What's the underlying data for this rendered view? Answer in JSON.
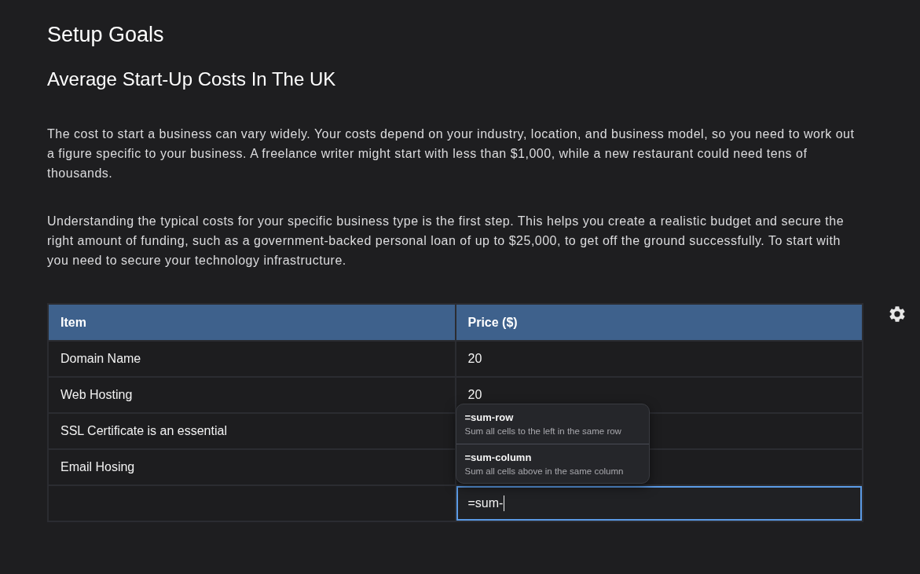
{
  "headings": {
    "title": "Setup Goals",
    "subtitle": "Average Start-Up Costs In The UK"
  },
  "paragraphs": [
    "The cost to start a business can vary widely. Your costs depend on your industry, location, and business model, so you need to work out a figure specific to your business. A freelance writer might start with less than $1,000, while a new restaurant could need tens of thousands.",
    "Understanding the typical costs for your specific business type is the first step. This helps you create a realistic budget and secure the right amount of funding, such as a government-backed personal loan of up to $25,000, to get off the ground successfully. To start with you need to secure your technology infrastructure."
  ],
  "table": {
    "columns": [
      "Item",
      "Price ($)"
    ],
    "rows": [
      {
        "item": "Domain Name",
        "price": "20"
      },
      {
        "item": "Web Hosting",
        "price": "20"
      },
      {
        "item": "SSL Certificate is an essential"
      },
      {
        "item": "Email Hosing"
      },
      {
        "input": {
          "value": "=sum-",
          "focused": true,
          "suggestions": [
            {
              "command": "=sum-row",
              "description": "Sum all cells to the left in the same row"
            },
            {
              "command": "=sum-column",
              "description": "Sum all cells above in the same column"
            }
          ]
        }
      }
    ]
  }
}
